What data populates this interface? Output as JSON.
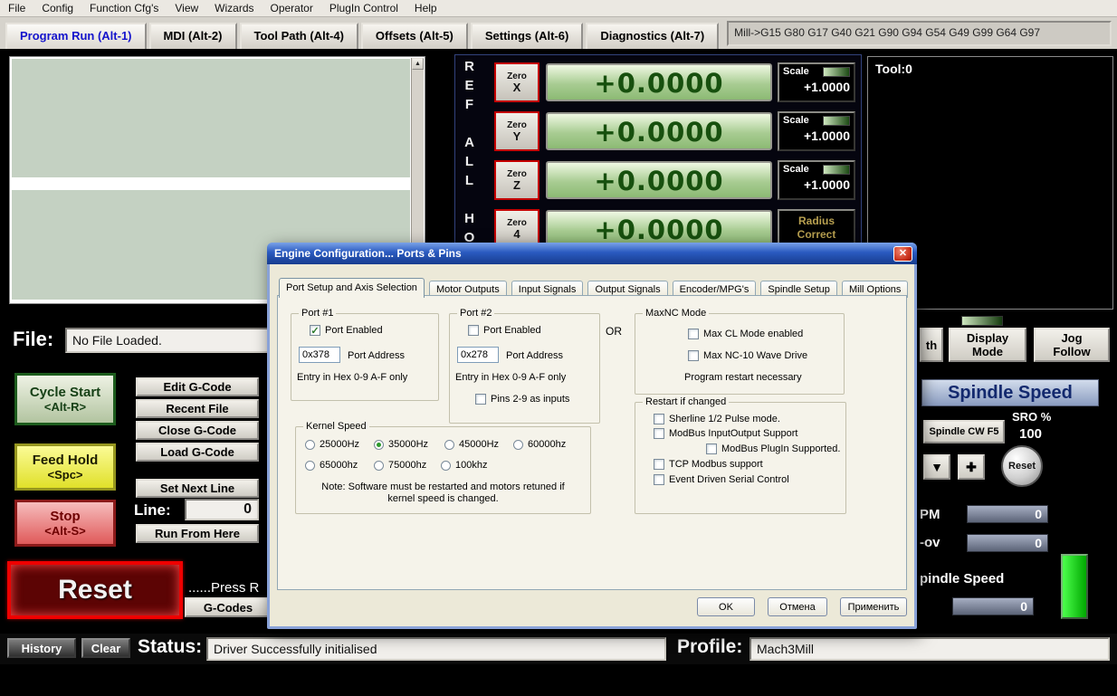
{
  "menu_bar": {
    "items": [
      "File",
      "Config",
      "Function Cfg's",
      "View",
      "Wizards",
      "Operator",
      "PlugIn Control",
      "Help"
    ]
  },
  "screen_tabs": {
    "items": [
      {
        "label": "Program Run (Alt-1)"
      },
      {
        "label": "MDI (Alt-2)"
      },
      {
        "label": "Tool Path (Alt-4)"
      },
      {
        "label": "Offsets (Alt-5)"
      },
      {
        "label": "Settings (Alt-6)"
      },
      {
        "label": "Diagnostics (Alt-7)"
      }
    ],
    "modal_string": "Mill->G15  G80 G17 G40 G21 G90 G94 G54 G49 G99 G64 G97"
  },
  "dro": {
    "ref_all_home": "REF ALL HOME",
    "rows": [
      {
        "zero_top": "Zero",
        "zero_axis": "X",
        "value": "+0.0000",
        "right_top": "Scale",
        "right_value": "+1.0000"
      },
      {
        "zero_top": "Zero",
        "zero_axis": "Y",
        "value": "+0.0000",
        "right_top": "Scale",
        "right_value": "+1.0000"
      },
      {
        "zero_top": "Zero",
        "zero_axis": "Z",
        "value": "+0.0000",
        "right_top": "Scale",
        "right_value": "+1.0000"
      },
      {
        "zero_top": "Zero",
        "zero_axis": "4",
        "value": "+0.0000",
        "right_top": "Radius",
        "right_value": "Correct"
      }
    ]
  },
  "tool_panel": {
    "label": "Tool:0"
  },
  "file_bar": {
    "label": "File:",
    "value": "No File Loaded."
  },
  "left_controls": {
    "cycle_start": {
      "line1": "Cycle Start",
      "line2": "<Alt-R>"
    },
    "feed_hold": {
      "line1": "Feed Hold",
      "line2": "<Spc>"
    },
    "stop": {
      "line1": "Stop",
      "line2": "<Alt-S>"
    }
  },
  "gcode_controls": {
    "buttons": [
      "Edit G-Code",
      "Recent File",
      "Close G-Code",
      "Load G-Code"
    ],
    "set_next_line": "Set Next Line",
    "line_label": "Line:",
    "line_value": "0",
    "run_from_here": "Run From Here"
  },
  "reset_area": {
    "reset": "Reset",
    "press_text": "......Press R",
    "gcodes": "G-Codes"
  },
  "right_panel": {
    "partial_button": "th",
    "display_mode": {
      "line1": "Display",
      "line2": "Mode"
    },
    "jog_follow": {
      "line1": "Jog",
      "line2": "Follow"
    },
    "spindle": {
      "header": "Spindle Speed",
      "cw_button": "Spindle CW F5",
      "sro_label": "SRO %",
      "sro_value": "100",
      "reset_button": "Reset",
      "rpm_label": "PM",
      "rpm_value": "0",
      "sov_label": "-ov",
      "sov_value": "0",
      "speed_label": "pindle Speed",
      "speed_value": "0"
    }
  },
  "status_bar": {
    "history": "History",
    "clear": "Clear",
    "status_label": "Status:",
    "status_value": "Driver Successfully initialised",
    "profile_label": "Profile:",
    "profile_value": "Mach3Mill"
  },
  "icons": {
    "close": "✕",
    "scroll_up": "▲",
    "scroll_down": "▼",
    "spindle_down": "▼",
    "spindle_up": "✚",
    "check": "✓"
  },
  "dialog": {
    "title": "Engine Configuration... Ports & Pins",
    "tabs": [
      {
        "label": "Port Setup and Axis Selection",
        "active": true
      },
      {
        "label": "Motor Outputs"
      },
      {
        "label": "Input Signals"
      },
      {
        "label": "Output Signals"
      },
      {
        "label": "Encoder/MPG's"
      },
      {
        "label": "Spindle Setup"
      },
      {
        "label": "Mill Options"
      }
    ],
    "port1": {
      "title": "Port #1",
      "enabled_label": "Port Enabled",
      "enabled_checked": true,
      "address_value": "0x378",
      "address_label": "Port Address",
      "hint": "Entry in Hex 0-9 A-F only"
    },
    "port2": {
      "title": "Port #2",
      "enabled_label": "Port Enabled",
      "enabled_checked": false,
      "address_value": "0x278",
      "address_label": "Port Address",
      "hint": "Entry in Hex 0-9 A-F only",
      "pins_label": "Pins 2-9 as inputs",
      "pins_checked": false
    },
    "or_label": "OR",
    "maxnc": {
      "title": "MaxNC Mode",
      "cl_label": "Max CL Mode enabled",
      "wave_label": "Max NC-10 Wave Drive",
      "note": "Program restart necessary"
    },
    "kernel": {
      "title": "Kernel Speed",
      "options": [
        "25000Hz",
        "35000Hz",
        "45000Hz",
        "60000hz",
        "65000hz",
        "75000hz",
        "100khz"
      ],
      "selected": "35000Hz",
      "note1": "Note: Software must be restarted and motors retuned if",
      "note2": "kernel speed is changed."
    },
    "restart": {
      "title": "Restart if changed",
      "options": [
        "Sherline 1/2 Pulse mode.",
        "ModBus InputOutput Support",
        "ModBus PlugIn Supported.",
        "TCP Modbus support",
        "Event Driven Serial Control"
      ]
    },
    "buttons": {
      "ok": "OK",
      "cancel": "Отмена",
      "apply": "Применить"
    }
  }
}
